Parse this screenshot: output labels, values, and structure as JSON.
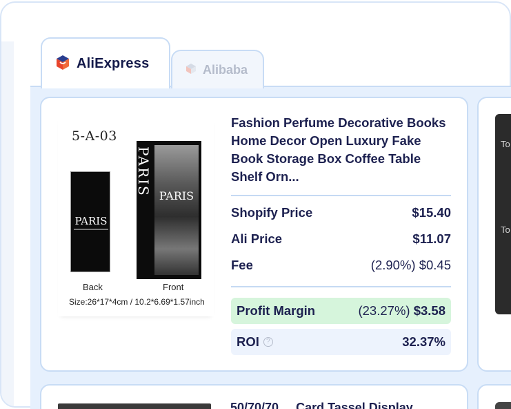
{
  "tabs": {
    "aliexpress": {
      "label": "AliExpress",
      "icon": "aliexpress-cart-icon"
    },
    "alibaba": {
      "label": "Alibaba",
      "icon": "alibaba-box-icon"
    }
  },
  "product": {
    "title": "Fashion Perfume Decorative Books Home Decor Open Luxury Fake Book Storage Box Coffee Table Shelf Orn...",
    "image": {
      "sku": "5-A-03",
      "back_title": "PARIS",
      "front_title": "PARIS",
      "spine_title": "PARIS",
      "back_label": "Back",
      "front_label": "Front",
      "size_text": "Size:26*17*4cm / 10.2*6.69*1.57inch"
    },
    "pricing": {
      "shopify_label": "Shopify Price",
      "shopify_value": "$15.40",
      "ali_label": "Ali Price",
      "ali_value": "$11.07",
      "fee_label": "Fee",
      "fee_value": "(2.90%) $0.45",
      "profit_label": "Profit Margin",
      "profit_percent": "(23.27%)",
      "profit_value": "$3.58",
      "roi_label": "ROI",
      "roi_value": "32.37%"
    }
  },
  "next_product": {
    "title_partial": "50/70/70 ... Card Tassel Display"
  },
  "side_thumb": {
    "text_1": "To",
    "text_2": "To"
  },
  "colors": {
    "accent_border": "#c8dcf5",
    "profit_bg": "#d6f5dc",
    "roi_bg": "#edf3fd",
    "text_dark": "#1d2150",
    "aliexpress_red": "#e8452c"
  }
}
